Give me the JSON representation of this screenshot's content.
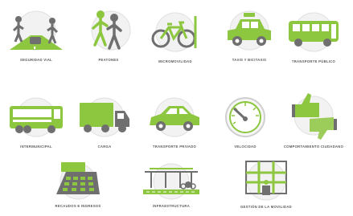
{
  "icons": [
    {
      "key": "seguridad",
      "label": "Seguridad vial",
      "icon": "road-safety-icon"
    },
    {
      "key": "peatones",
      "label": "Peatones",
      "icon": "pedestrians-icon"
    },
    {
      "key": "micro",
      "label": "Micromovilidad",
      "icon": "bicycle-icon"
    },
    {
      "key": "taxis",
      "label": "Taxis y bicitaxis",
      "icon": "taxi-icon"
    },
    {
      "key": "publico",
      "label": "Transporte público",
      "icon": "bus-icon"
    },
    {
      "key": "intermunicipal",
      "label": "Intermunicipal",
      "icon": "coach-bus-icon"
    },
    {
      "key": "carga",
      "label": "Carga",
      "icon": "truck-icon"
    },
    {
      "key": "privado",
      "label": "Transporte privado",
      "icon": "car-icon"
    },
    {
      "key": "velocidad",
      "label": "Velocidad",
      "icon": "speedometer-icon"
    },
    {
      "key": "comportamiento",
      "label": "Comportamiento ciudadano",
      "icon": "thumbs-icon"
    },
    {
      "key": "recaudos",
      "label": "Recaudos e ingresos",
      "icon": "calculator-icon"
    },
    {
      "key": "infra",
      "label": "Infraestructura",
      "icon": "infrastructure-icon"
    },
    {
      "key": "gestion",
      "label": "Gestión de la Movilidad",
      "icon": "mobility-management-icon"
    }
  ],
  "colors": {
    "accent": "#8dc63f",
    "label": "#5a5a5a",
    "gray": "#6f6f6f"
  }
}
